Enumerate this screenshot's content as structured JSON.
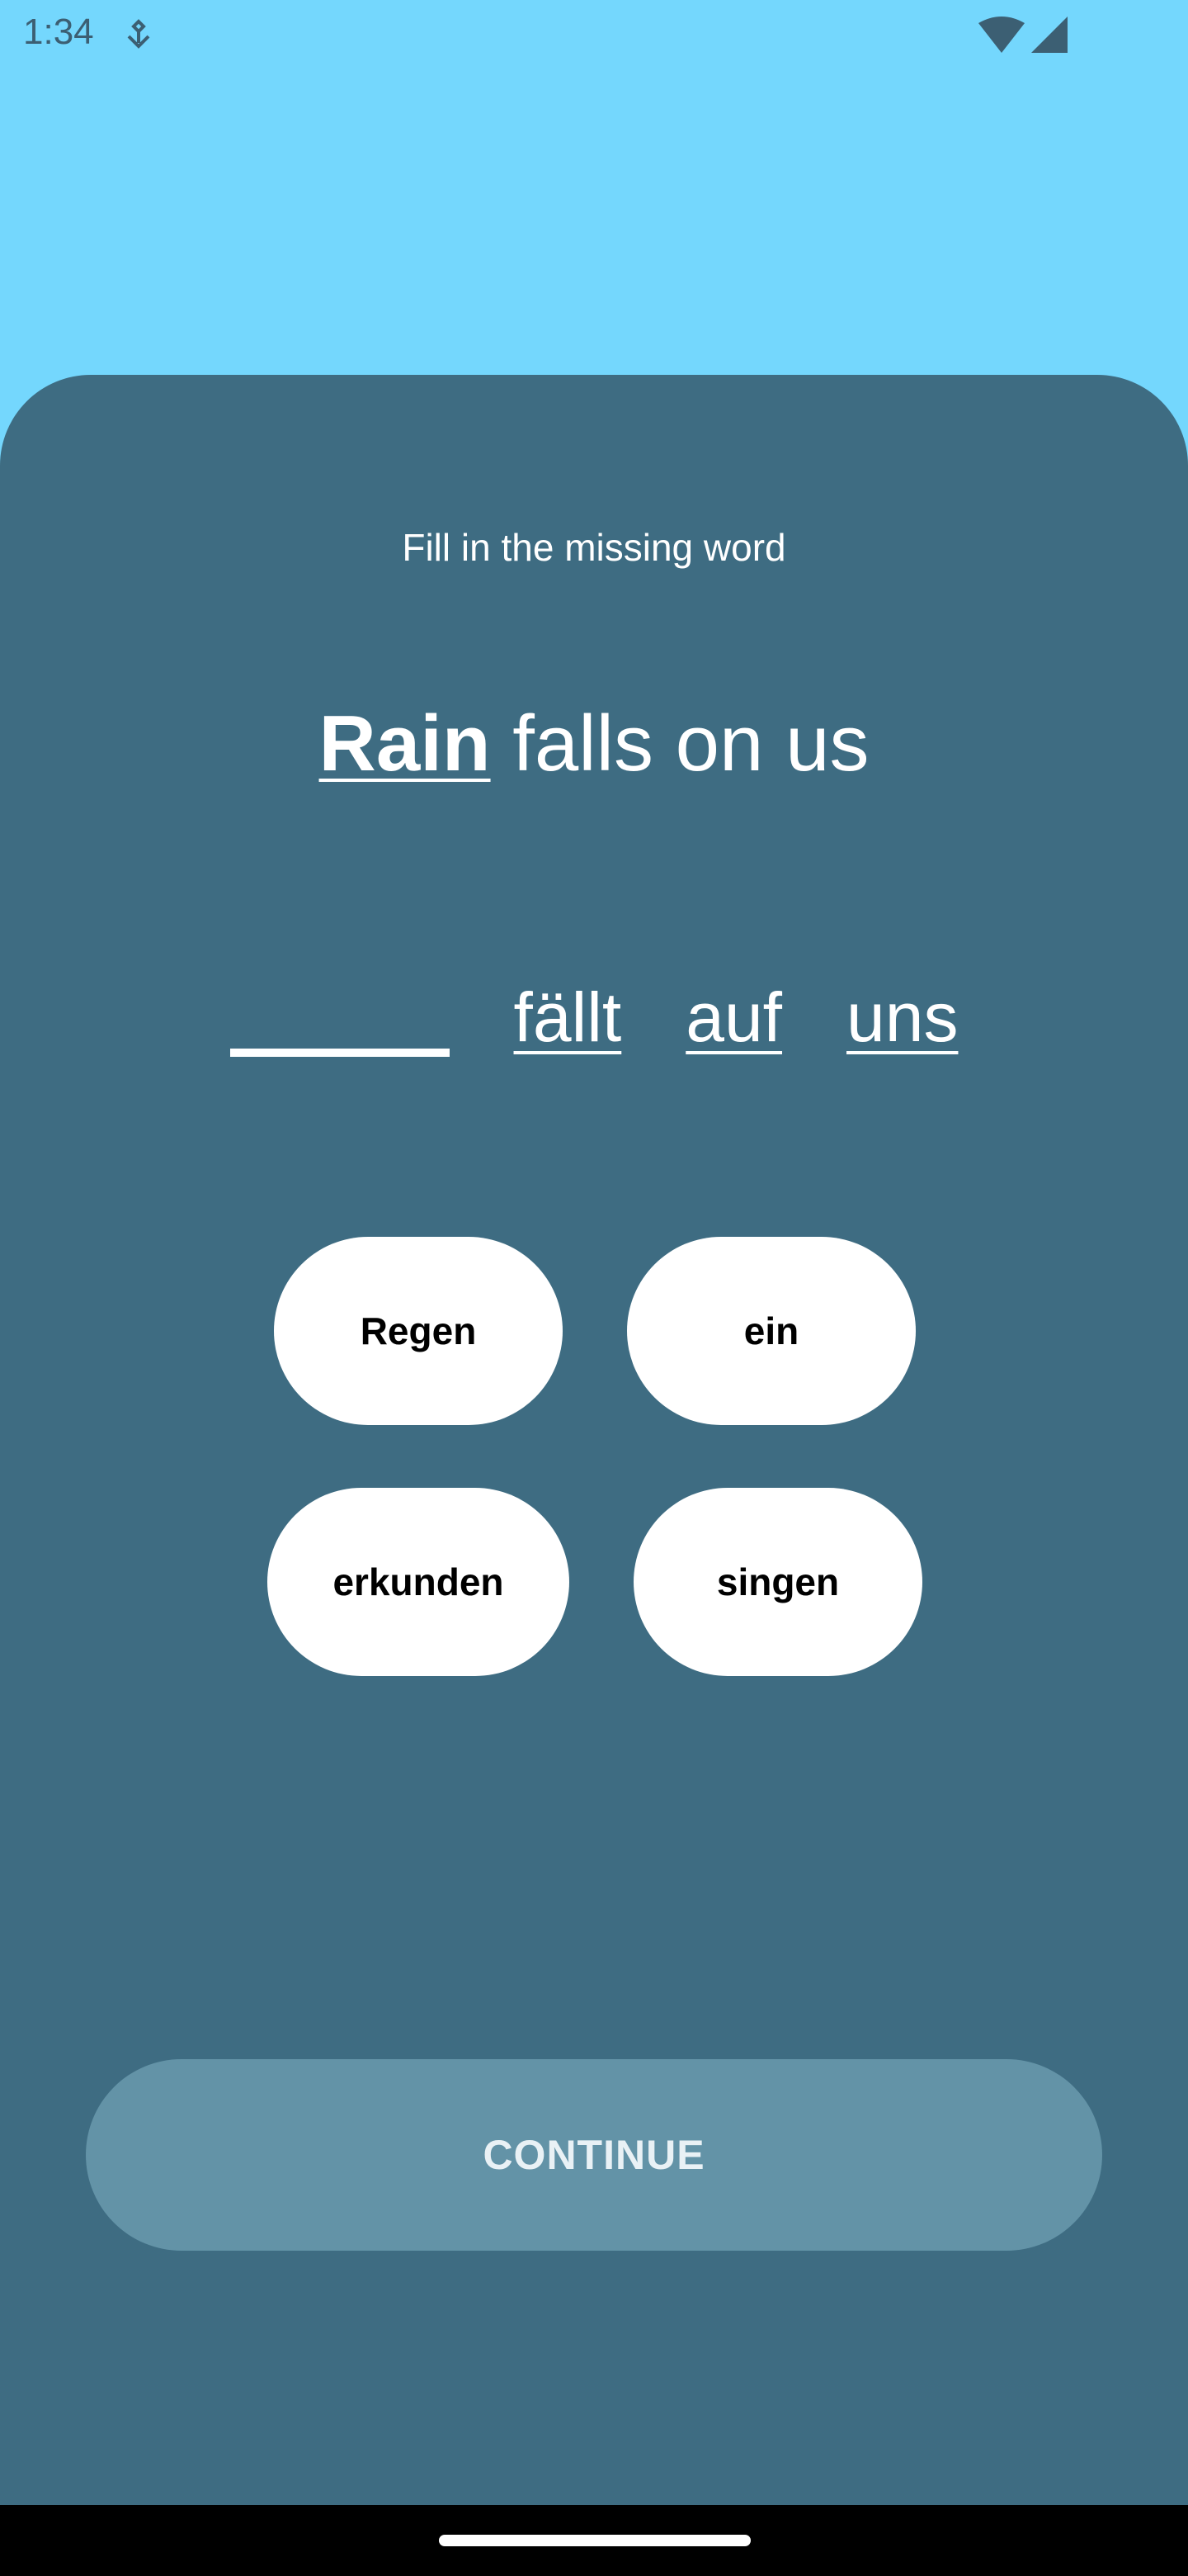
{
  "status_bar": {
    "time": "1:34",
    "icons": [
      "notification-icon",
      "wifi-icon",
      "cell-signal-icon"
    ]
  },
  "exercise": {
    "instruction": "Fill in the missing word",
    "source_sentence": {
      "highlighted_word": "Rain",
      "rest": "falls on us"
    },
    "target_sentence": {
      "blank": "",
      "words": [
        "fällt",
        "auf",
        "uns"
      ]
    },
    "options": [
      "Regen",
      "ein",
      "erkunden",
      "singen"
    ]
  },
  "footer": {
    "continue_label": "CONTINUE"
  },
  "colors": {
    "sky": "#74d7fd",
    "card": "#3e6c82",
    "continue_disabled": "#6393a7",
    "option_bg": "#ffffff"
  }
}
